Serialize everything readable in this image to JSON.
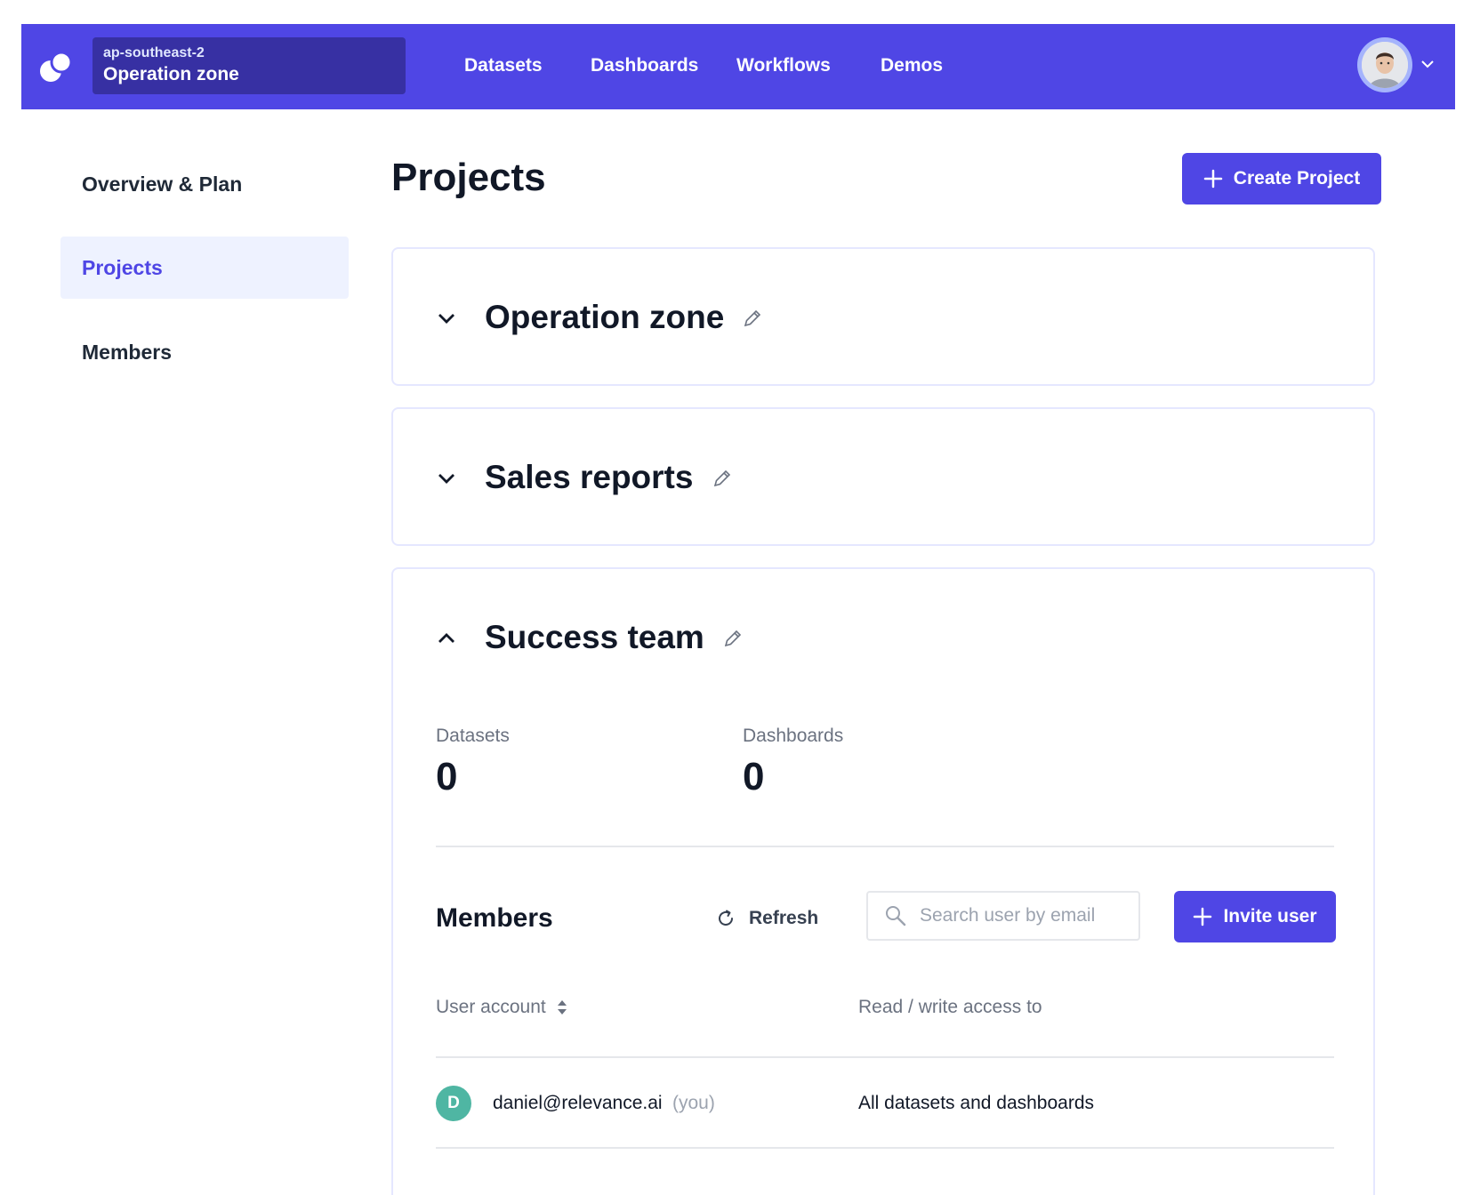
{
  "header": {
    "region": "ap-southeast-2",
    "zone_name": "Operation zone",
    "nav": [
      "Datasets",
      "Dashboards",
      "Workflows",
      "Demos"
    ],
    "accent_color": "#4f46e5"
  },
  "sidebar": {
    "items": [
      {
        "label": "Overview & Plan",
        "active": false
      },
      {
        "label": "Projects",
        "active": true
      },
      {
        "label": "Members",
        "active": false
      }
    ]
  },
  "main": {
    "title": "Projects",
    "create_button": "Create Project",
    "projects": [
      {
        "name": "Operation zone",
        "expanded": false
      },
      {
        "name": "Sales reports",
        "expanded": false
      },
      {
        "name": "Success team",
        "expanded": true,
        "stats": [
          {
            "label": "Datasets",
            "value": "0"
          },
          {
            "label": "Dashboards",
            "value": "0"
          }
        ],
        "members": {
          "title": "Members",
          "refresh_label": "Refresh",
          "search_placeholder": "Search user by email",
          "invite_button": "Invite user",
          "columns": [
            "User account",
            "Read / write access to"
          ],
          "rows": [
            {
              "initial": "D",
              "email": "daniel@relevance.ai",
              "tag": "(you)",
              "access": "All datasets and dashboards"
            }
          ]
        }
      }
    ]
  },
  "icons": [
    "logo-icon",
    "avatar-image",
    "chevron-down-icon",
    "plus-icon",
    "pencil-icon",
    "chevron-up-icon",
    "refresh-icon",
    "search-icon",
    "sort-icon"
  ]
}
